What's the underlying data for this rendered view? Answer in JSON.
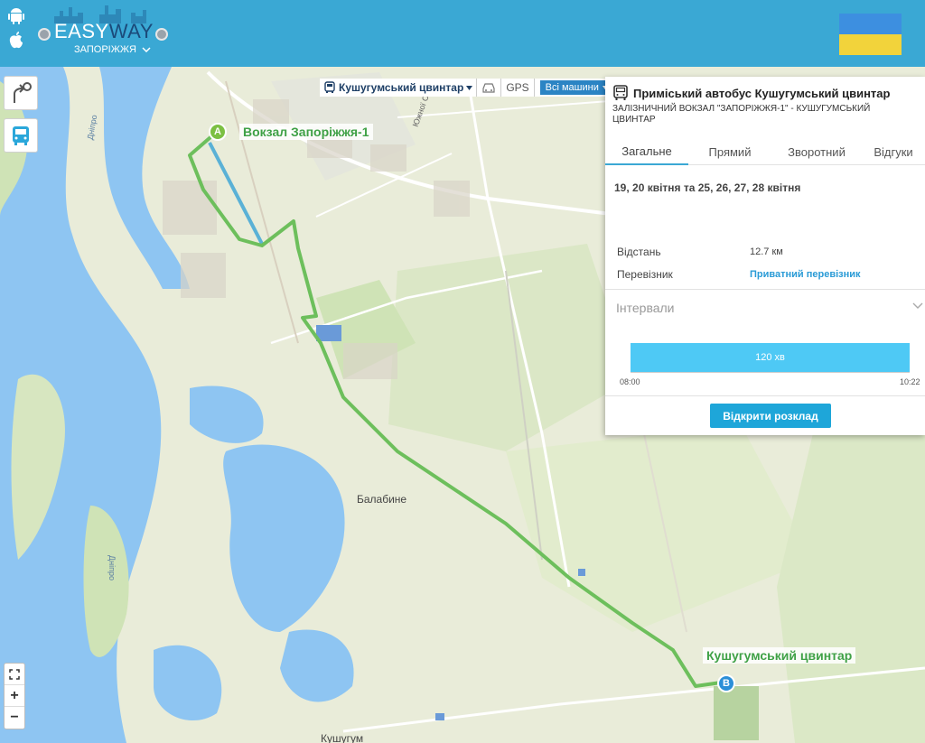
{
  "header": {
    "logo_easy": "EASY",
    "logo_way": "WAY",
    "city": "ЗАПОРІЖЖЯ",
    "icons": [
      "android-icon",
      "apple-icon"
    ]
  },
  "toolbar": {
    "route": "Кушугумський цвинтар",
    "gps": "GPS",
    "all_vehicles": "Всі машини"
  },
  "map": {
    "labels": {
      "balabyne": "Балабине",
      "kushugum": "Кушугум",
      "dnipro_1": "Дніпро",
      "dnipro_2": "Дніпро",
      "street": "Южної Ст"
    },
    "stops": {
      "a_pin": "A",
      "a_name": "Вокзал Запоріжжя-1",
      "b_pin": "B",
      "b_name": "Кушугумський цвинтар"
    },
    "zoom": {
      "plus": "+",
      "minus": "−"
    },
    "colors": {
      "route": "#6dbf5c",
      "water": "#8ec5f2",
      "land": "#e9ecd9",
      "park": "#cfe3b6"
    }
  },
  "panel": {
    "title": "Приміський автобус Кушугумський цвинтар",
    "subtitle": "ЗАЛІЗНИЧНИЙ ВОКЗАЛ \"ЗАПОРІЖЖЯ-1\" - КУШУГУМСЬКИЙ ЦВИНТАР",
    "tabs": [
      "Загальне",
      "Прямий",
      "Зворотний",
      "Відгуки"
    ],
    "dates": "19, 20 квітня та 25, 26, 27, 28 квітня",
    "distance_label": "Відстань",
    "distance_value": "12.7 км",
    "carrier_label": "Перевізник",
    "carrier_value": "Приватний перевізник",
    "intervals_label": "Інтервали",
    "interval_value": "120 хв",
    "time_start": "08:00",
    "time_end": "10:22",
    "schedule_button": "Відкрити розклад"
  }
}
